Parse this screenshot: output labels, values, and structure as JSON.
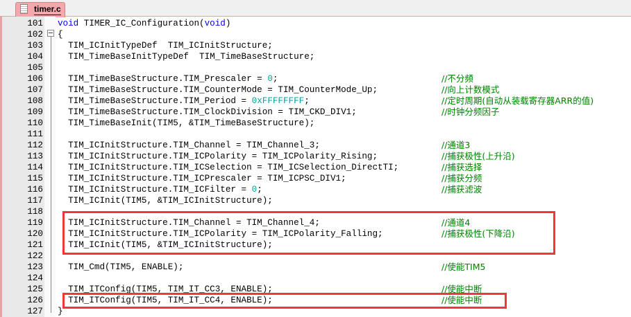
{
  "tab": {
    "label": "timer.c",
    "icon": "file-icon"
  },
  "lines": [
    {
      "n": "101",
      "segs": [
        {
          "t": "void",
          "c": "kw"
        },
        {
          "t": " TIMER_IC_Configuration(",
          "c": ""
        },
        {
          "t": "void",
          "c": "kw"
        },
        {
          "t": ")",
          "c": ""
        }
      ],
      "cm": ""
    },
    {
      "n": "102",
      "segs": [
        {
          "t": "{",
          "c": ""
        }
      ],
      "cm": ""
    },
    {
      "n": "103",
      "segs": [
        {
          "t": "  TIM_ICInitTypeDef  TIM_ICInitStructure;",
          "c": ""
        }
      ],
      "cm": ""
    },
    {
      "n": "104",
      "segs": [
        {
          "t": "  TIM_TimeBaseInitTypeDef  TIM_TimeBaseStructure;",
          "c": ""
        }
      ],
      "cm": ""
    },
    {
      "n": "105",
      "segs": [],
      "cm": ""
    },
    {
      "n": "106",
      "segs": [
        {
          "t": "  TIM_TimeBaseStructure.TIM_Prescaler = ",
          "c": ""
        },
        {
          "t": "0",
          "c": "num"
        },
        {
          "t": ";",
          "c": ""
        }
      ],
      "cm": "//不分频"
    },
    {
      "n": "107",
      "segs": [
        {
          "t": "  TIM_TimeBaseStructure.TIM_CounterMode = TIM_CounterMode_Up;",
          "c": ""
        }
      ],
      "cm": "//向上计数模式"
    },
    {
      "n": "108",
      "segs": [
        {
          "t": "  TIM_TimeBaseStructure.TIM_Period = ",
          "c": ""
        },
        {
          "t": "0xFFFFFFFF",
          "c": "num"
        },
        {
          "t": ";",
          "c": ""
        }
      ],
      "cm": "//定时周期(自动从装载寄存器ARR的值)"
    },
    {
      "n": "109",
      "segs": [
        {
          "t": "  TIM_TimeBaseStructure.TIM_ClockDivision = TIM_CKD_DIV1;",
          "c": ""
        }
      ],
      "cm": "//时钟分频因子"
    },
    {
      "n": "110",
      "segs": [
        {
          "t": "  TIM_TimeBaseInit(TIM5, &TIM_TimeBaseStructure);",
          "c": ""
        }
      ],
      "cm": ""
    },
    {
      "n": "111",
      "segs": [],
      "cm": ""
    },
    {
      "n": "112",
      "segs": [
        {
          "t": "  TIM_ICInitStructure.TIM_Channel = TIM_Channel_3;",
          "c": ""
        }
      ],
      "cm": "//通道3"
    },
    {
      "n": "113",
      "segs": [
        {
          "t": "  TIM_ICInitStructure.TIM_ICPolarity = TIM_ICPolarity_Rising;",
          "c": ""
        }
      ],
      "cm": "//捕获极性(上升沿)"
    },
    {
      "n": "114",
      "segs": [
        {
          "t": "  TIM_ICInitStructure.TIM_ICSelection = TIM_ICSelection_DirectTI;",
          "c": ""
        }
      ],
      "cm": "//捕获选择"
    },
    {
      "n": "115",
      "segs": [
        {
          "t": "  TIM_ICInitStructure.TIM_ICPrescaler = TIM_ICPSC_DIV1;",
          "c": ""
        }
      ],
      "cm": "//捕获分频"
    },
    {
      "n": "116",
      "segs": [
        {
          "t": "  TIM_ICInitStructure.TIM_ICFilter = ",
          "c": ""
        },
        {
          "t": "0",
          "c": "num"
        },
        {
          "t": ";",
          "c": ""
        }
      ],
      "cm": "//捕获滤波"
    },
    {
      "n": "117",
      "segs": [
        {
          "t": "  TIM_ICInit(TIM5, &TIM_ICInitStructure);",
          "c": ""
        }
      ],
      "cm": ""
    },
    {
      "n": "118",
      "segs": [],
      "cm": ""
    },
    {
      "n": "119",
      "segs": [
        {
          "t": "  TIM_ICInitStructure.TIM_Channel = TIM_Channel_4;",
          "c": ""
        }
      ],
      "cm": "//通道4"
    },
    {
      "n": "120",
      "segs": [
        {
          "t": "  TIM_ICInitStructure.TIM_ICPolarity = TIM_ICPolarity_Falling;",
          "c": ""
        }
      ],
      "cm": "//捕获极性(下降沿)"
    },
    {
      "n": "121",
      "segs": [
        {
          "t": "  TIM_ICInit(TIM5, &TIM_ICInitStructure);",
          "c": ""
        }
      ],
      "cm": ""
    },
    {
      "n": "122",
      "segs": [],
      "cm": ""
    },
    {
      "n": "123",
      "segs": [
        {
          "t": "  TIM_Cmd(TIM5, ENABLE);",
          "c": ""
        }
      ],
      "cm": "//使能TIM5"
    },
    {
      "n": "124",
      "segs": [],
      "cm": ""
    },
    {
      "n": "125",
      "segs": [
        {
          "t": "  TIM_ITConfig(TIM5, TIM_IT_CC3, ENABLE);",
          "c": ""
        }
      ],
      "cm": "//使能中断"
    },
    {
      "n": "126",
      "segs": [
        {
          "t": "  TIM_ITConfig(TIM5, TIM_IT_CC4, ENABLE);",
          "c": ""
        }
      ],
      "cm": "//使能中断"
    },
    {
      "n": "127",
      "segs": [
        {
          "t": "}",
          "c": ""
        }
      ],
      "cm": ""
    }
  ]
}
